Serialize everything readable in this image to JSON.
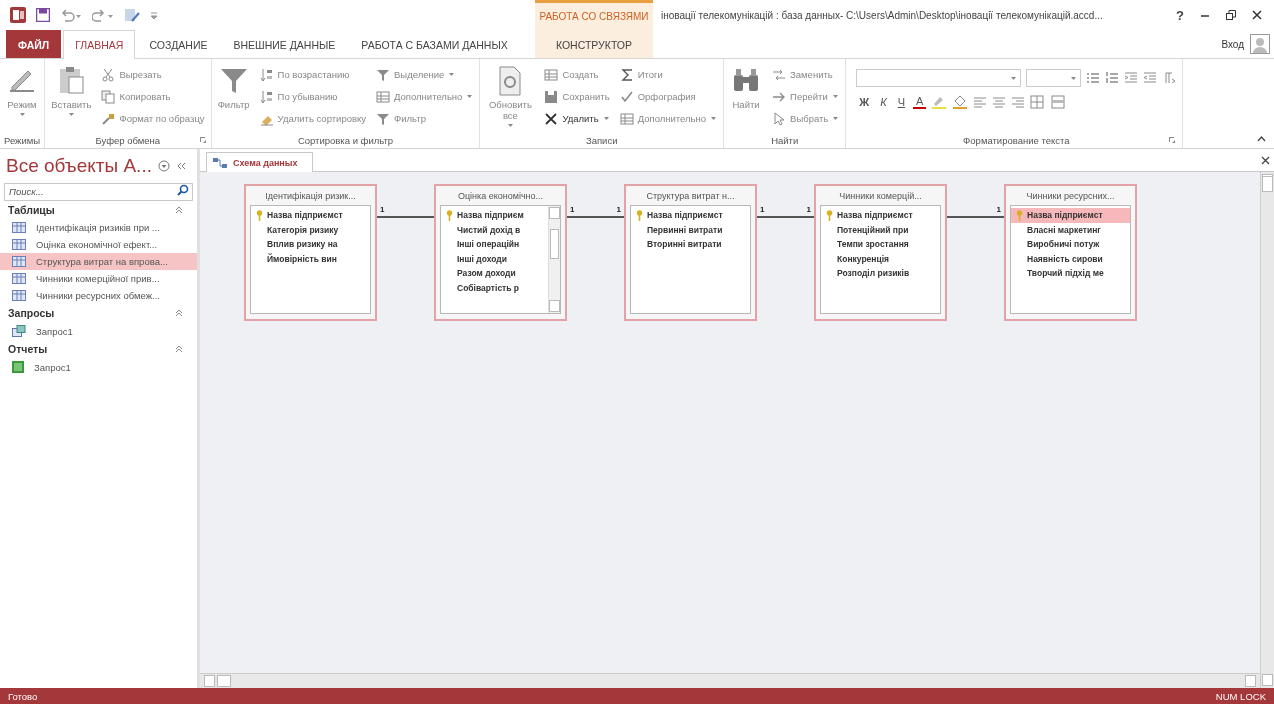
{
  "title_bar": {
    "context_group": "РАБОТА СО СВЯЗЯМИ",
    "title": "іновації телекомунікацій : база данных- C:\\Users\\Admin\\Desktop\\іновації телекомунікацій.accd...",
    "help": "?"
  },
  "tabs": [
    {
      "label": "ФАЙЛ",
      "kind": "file",
      "selected": false
    },
    {
      "label": "ГЛАВНАЯ",
      "kind": "normal",
      "selected": true
    },
    {
      "label": "СОЗДАНИЕ",
      "kind": "normal",
      "selected": false
    },
    {
      "label": "ВНЕШНИЕ ДАННЫЕ",
      "kind": "normal",
      "selected": false
    },
    {
      "label": "РАБОТА С БАЗАМИ ДАННЫХ",
      "kind": "normal",
      "selected": false
    },
    {
      "label": "КОНСТРУКТОР",
      "kind": "context",
      "selected": false
    }
  ],
  "sign_in": "Вход",
  "ribbon": {
    "groups": [
      {
        "label": "Режимы",
        "kind": "commands",
        "launcher": false,
        "large": {
          "label": "Режим",
          "disabled": true,
          "dropdown": true
        }
      },
      {
        "label": "Буфер обмена",
        "kind": "commands",
        "launcher": true,
        "large": {
          "label": "Вставить",
          "disabled": true,
          "dropdown": true
        },
        "columns": [
          [
            {
              "label": "Вырезать",
              "disabled": true,
              "dropdown": false
            },
            {
              "label": "Копировать",
              "disabled": true,
              "dropdown": false
            },
            {
              "label": "Формат по образцу",
              "disabled": true,
              "dropdown": false
            }
          ]
        ]
      },
      {
        "label": "Сортировка и фильтр",
        "kind": "commands",
        "launcher": false,
        "large": {
          "label": "Фильтр",
          "disabled": true,
          "dropdown": false
        },
        "columns": [
          [
            {
              "label": "По возрастанию",
              "disabled": true,
              "dropdown": false
            },
            {
              "label": "По убыванию",
              "disabled": true,
              "dropdown": false
            },
            {
              "label": "Удалить сортировку",
              "disabled": true,
              "dropdown": false
            }
          ],
          [
            {
              "label": "Выделение",
              "disabled": true,
              "dropdown": true
            },
            {
              "label": "Дополнительно",
              "disabled": true,
              "dropdown": true
            },
            {
              "label": "Фильтр",
              "disabled": true,
              "dropdown": false
            }
          ]
        ]
      },
      {
        "label": "Записи",
        "kind": "commands",
        "launcher": false,
        "large": {
          "label": "Обновить все",
          "disabled": true,
          "dropdown": true
        },
        "columns": [
          [
            {
              "label": "Создать",
              "disabled": true,
              "dropdown": false
            },
            {
              "label": "Сохранить",
              "disabled": true,
              "dropdown": false
            },
            {
              "label": "Удалить",
              "disabled": false,
              "dropdown": true
            }
          ],
          [
            {
              "label": "Итоги",
              "disabled": true,
              "dropdown": false
            },
            {
              "label": "Орфография",
              "disabled": true,
              "dropdown": false
            },
            {
              "label": "Дополнительно",
              "disabled": true,
              "dropdown": true
            }
          ]
        ]
      },
      {
        "label": "Найти",
        "kind": "commands",
        "launcher": false,
        "large": {
          "label": "Найти",
          "disabled": true,
          "dropdown": false
        },
        "columns": [
          [
            {
              "label": "Заменить",
              "disabled": true,
              "dropdown": false
            },
            {
              "label": "Перейти",
              "disabled": true,
              "dropdown": true
            },
            {
              "label": "Выбрать",
              "disabled": true,
              "dropdown": true
            }
          ]
        ]
      },
      {
        "label": "Форматирование текста",
        "kind": "format",
        "launcher": true,
        "letter_buttons": [
          {
            "label": "Ж",
            "kind": "bold"
          },
          {
            "label": "К",
            "kind": "italic"
          },
          {
            "label": "Ч",
            "kind": "underline"
          },
          {
            "label": "A",
            "kind": "font_color"
          }
        ]
      }
    ]
  },
  "sidebar": {
    "title": "Все объекты A...",
    "search": {
      "placeholder": "Поиск..."
    },
    "sections": [
      {
        "label": "Таблицы",
        "kind": "table",
        "items": [
          {
            "label": "Ідентифікація ризиків при ...",
            "selected": false
          },
          {
            "label": "Оцінка економічної ефект...",
            "selected": false
          },
          {
            "label": "Структура витрат на впрова...",
            "selected": true
          },
          {
            "label": "Чинники комерційної прив...",
            "selected": false
          },
          {
            "label": "Чинники ресурсних обмеж...",
            "selected": false
          }
        ]
      },
      {
        "label": "Запросы",
        "kind": "query",
        "items": [
          {
            "label": "Запрос1",
            "selected": false
          }
        ]
      },
      {
        "label": "Отчеты",
        "kind": "report",
        "items": [
          {
            "label": "Запрос1",
            "selected": false
          }
        ]
      }
    ]
  },
  "document_tab": {
    "label": "Схема данных",
    "selected": true
  },
  "diagram": {
    "tables": [
      {
        "title": "Ідентифікація ризик...",
        "scrollbar": false,
        "fields": [
          {
            "label": "Назва підприємст",
            "key": true,
            "selected": false
          },
          {
            "label": "Категорія ризику",
            "key": false,
            "selected": false
          },
          {
            "label": "Вплив ризику на",
            "key": false,
            "selected": false
          },
          {
            "label": "Ймовірність вин",
            "key": false,
            "selected": false
          }
        ]
      },
      {
        "title": "Оцінка економічно...",
        "scrollbar": true,
        "fields": [
          {
            "label": "Назва підприєм",
            "key": true,
            "selected": false
          },
          {
            "label": "Чистий дохід в",
            "key": false,
            "selected": false
          },
          {
            "label": "Інші операційн",
            "key": false,
            "selected": false
          },
          {
            "label": "Інші доходи",
            "key": false,
            "selected": false
          },
          {
            "label": "Разом доходи",
            "key": false,
            "selected": false
          },
          {
            "label": "Собівартість р",
            "key": false,
            "selected": false
          }
        ]
      },
      {
        "title": "Структура витрат н...",
        "scrollbar": false,
        "fields": [
          {
            "label": "Назва підприємст",
            "key": true,
            "selected": false
          },
          {
            "label": "Первинні витрати",
            "key": false,
            "selected": false
          },
          {
            "label": "Вторинні витрати",
            "key": false,
            "selected": false
          }
        ]
      },
      {
        "title": "Чинники комерцій...",
        "scrollbar": false,
        "fields": [
          {
            "label": "Назва підприємст",
            "key": true,
            "selected": false
          },
          {
            "label": "Потенційний при",
            "key": false,
            "selected": false
          },
          {
            "label": "Темпи зростання",
            "key": false,
            "selected": false
          },
          {
            "label": "Конкуренція",
            "key": false,
            "selected": false
          },
          {
            "label": "Розподіл ризиків",
            "key": false,
            "selected": false
          }
        ]
      },
      {
        "title": "Чинники ресурсних...",
        "scrollbar": false,
        "fields": [
          {
            "label": "Назва підприємст",
            "key": true,
            "selected": true
          },
          {
            "label": "Власні маркетинг",
            "key": false,
            "selected": false
          },
          {
            "label": "Виробничі потуж",
            "key": false,
            "selected": false
          },
          {
            "label": "Наявність сирови",
            "key": false,
            "selected": false
          },
          {
            "label": "Творчий підхід ме",
            "key": false,
            "selected": false
          }
        ]
      }
    ],
    "links": [
      {
        "start_label": "1"
      },
      {
        "start_label": "1",
        "end_label": "1"
      },
      {
        "start_label": "1",
        "end_label": "1"
      },
      {
        "end_label": "1"
      }
    ]
  },
  "status_bar": {
    "left": "Готово",
    "right": "NUM LOCK"
  }
}
